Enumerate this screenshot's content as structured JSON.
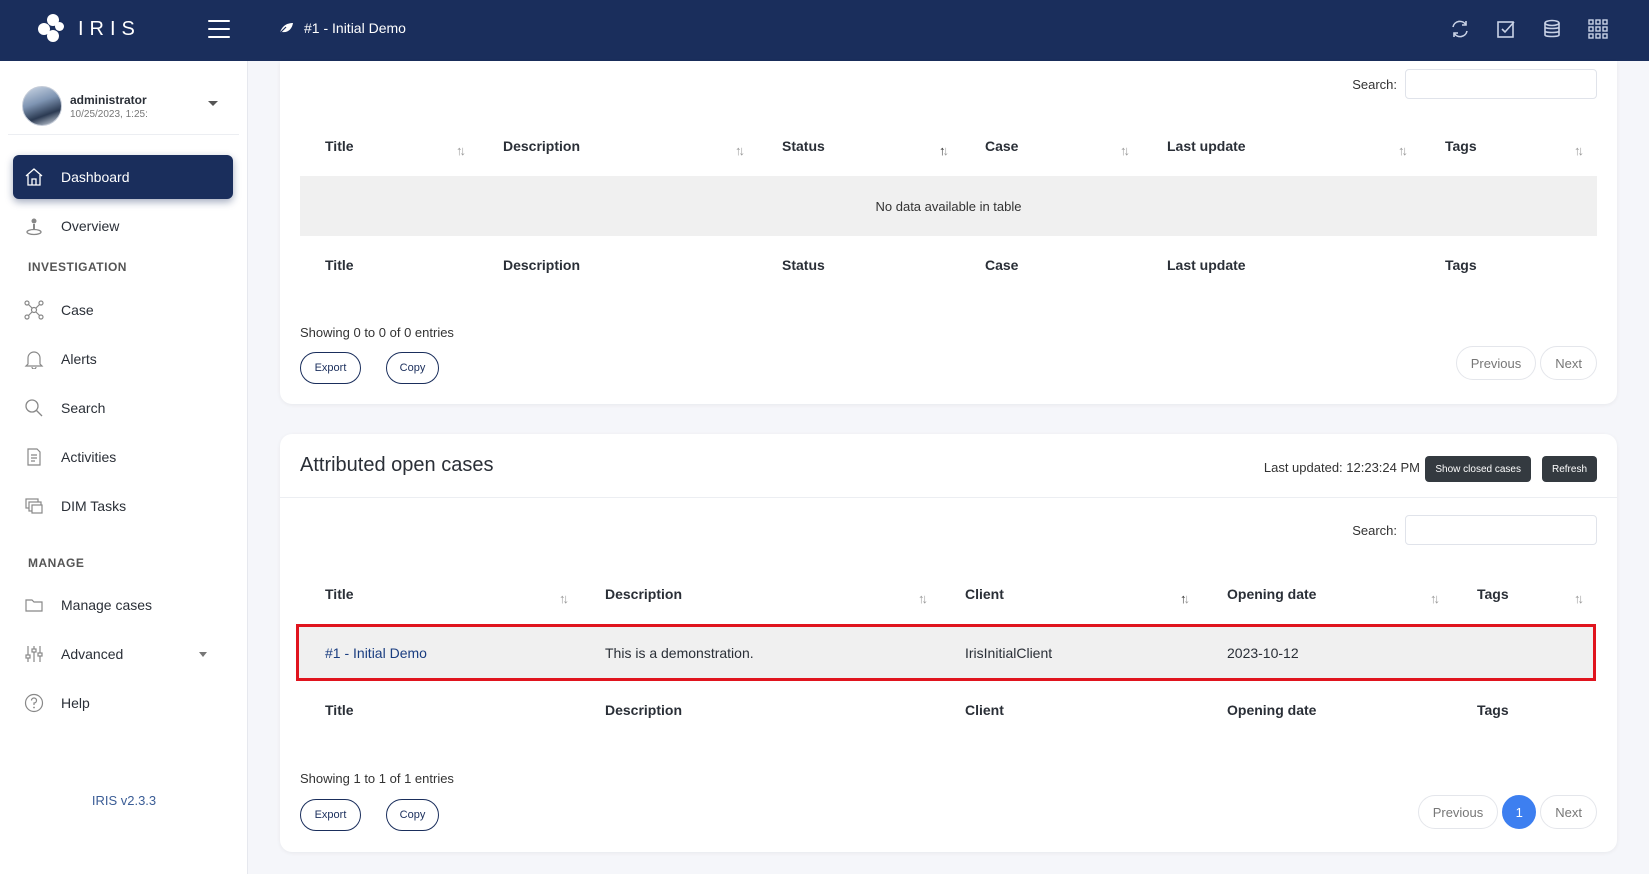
{
  "topbar": {
    "logo": "IRIS",
    "breadcrumb": "#1 - Initial Demo",
    "icons": [
      "refresh-icon",
      "checkbox-icon",
      "database-icon",
      "apps-grid-icon"
    ]
  },
  "user": {
    "name": "administrator",
    "datetime": "10/25/2023, 1:25:"
  },
  "sidebar": {
    "items": [
      {
        "label": "Dashboard",
        "icon": "home-icon"
      },
      {
        "label": "Overview",
        "icon": "pin-icon"
      },
      {
        "label": "Case",
        "icon": "network-icon"
      },
      {
        "label": "Alerts",
        "icon": "bell-icon"
      },
      {
        "label": "Search",
        "icon": "search-icon"
      },
      {
        "label": "Activities",
        "icon": "document-icon"
      },
      {
        "label": "DIM Tasks",
        "icon": "stack-icon"
      },
      {
        "label": "Manage cases",
        "icon": "folder-icon"
      },
      {
        "label": "Advanced",
        "icon": "sliders-icon"
      },
      {
        "label": "Help",
        "icon": "help-icon"
      }
    ],
    "sections": [
      "INVESTIGATION",
      "MANAGE"
    ],
    "version": "IRIS v2.3.3"
  },
  "table1": {
    "search_label": "Search:",
    "search_value": "",
    "columns": [
      "Title",
      "Description",
      "Status",
      "Case",
      "Last update",
      "Tags"
    ],
    "empty": "No data available in table",
    "info": "Showing 0 to 0 of 0 entries",
    "export": "Export",
    "copy": "Copy",
    "previous": "Previous",
    "next": "Next"
  },
  "cases": {
    "title": "Attributed open cases",
    "last_updated": "Last updated: 12:23:24 PM",
    "show_closed": "Show closed cases",
    "refresh": "Refresh",
    "search_label": "Search:",
    "search_value": "",
    "columns": [
      "Title",
      "Description",
      "Client",
      "Opening date",
      "Tags"
    ],
    "rows": [
      {
        "title": "#1 - Initial Demo",
        "description": "This is a demonstration.",
        "client": "IrisInitialClient",
        "opening_date": "2023-10-12",
        "tags": ""
      }
    ],
    "info": "Showing 1 to 1 of 1 entries",
    "export": "Export",
    "copy": "Copy",
    "previous": "Previous",
    "page": "1",
    "next": "Next"
  },
  "colors": {
    "navy": "#1a2e5c",
    "highlight": "#e0141e",
    "page_active": "#3d7ff0"
  }
}
